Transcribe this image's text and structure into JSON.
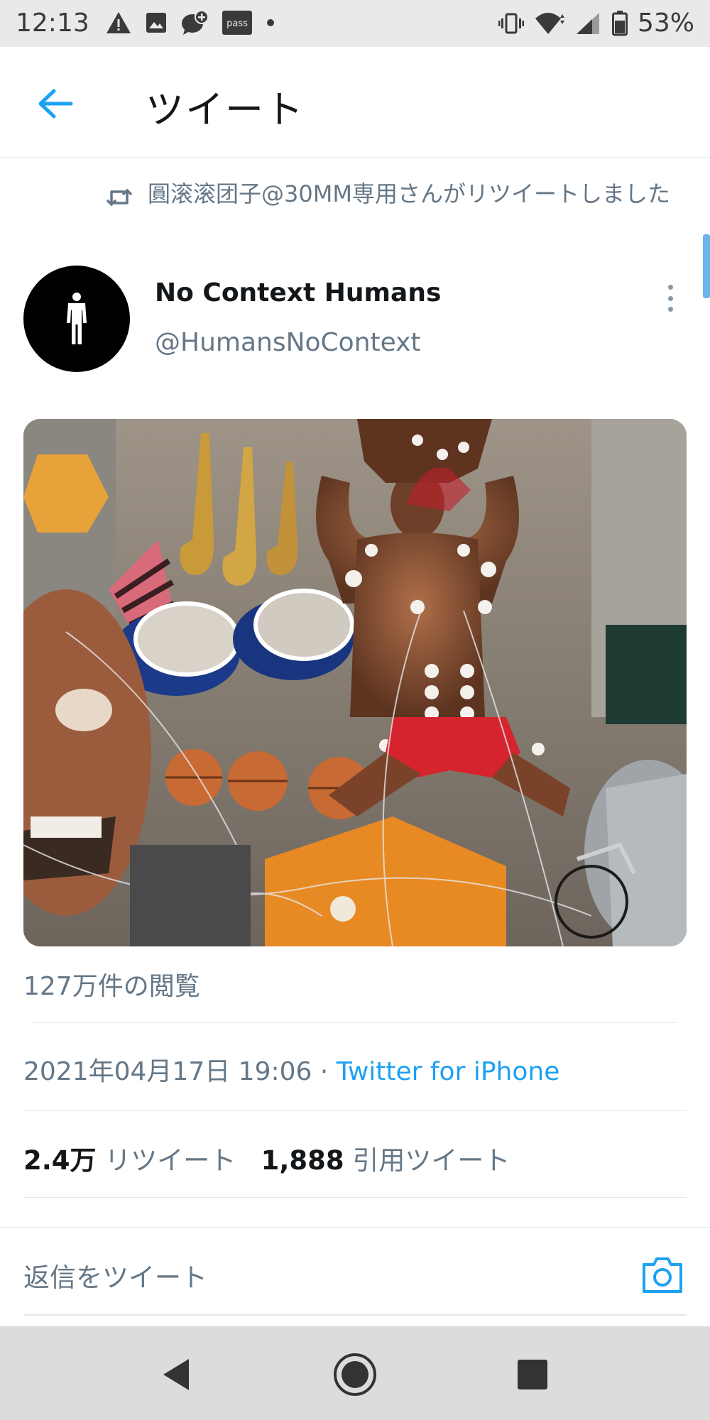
{
  "status_bar": {
    "time": "12:13",
    "battery": "53%",
    "left_icons": [
      "warning-icon",
      "image-icon",
      "chat-add-icon",
      "pass-icon",
      "dot-icon"
    ],
    "pass_label": "pass",
    "right_icons": [
      "vibrate-icon",
      "wifi-icon",
      "signal-icon",
      "battery-icon"
    ]
  },
  "app_bar": {
    "title": "ツイート",
    "back_icon": "back-arrow-icon"
  },
  "retweet_context": {
    "text": "圓滚滚团子@30MM専用さんがリツイートしました"
  },
  "author": {
    "name": "No Context Humans",
    "handle": "@HumansNoContext"
  },
  "tweet": {
    "views": "127万件の閲覧",
    "date": "2021年04月17日 19:06",
    "separator": " · ",
    "source": "Twitter for iPhone",
    "retweet_count": "2.4万",
    "retweet_label": "リツイート",
    "quote_count": "1,888",
    "quote_label": "引用ツイート"
  },
  "reply": {
    "placeholder": "返信をツイート"
  },
  "colors": {
    "accent": "#1da1f2",
    "secondary_text": "#657786",
    "divider": "#e1e8ed"
  }
}
